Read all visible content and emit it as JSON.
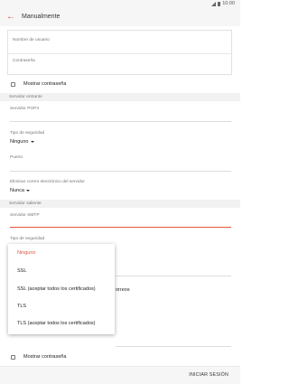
{
  "status_bar": {
    "time": "10:00"
  },
  "header": {
    "title": "Manualmente"
  },
  "account": {
    "username_label": "Nombre de usuario",
    "password_label": "Contraseña"
  },
  "show_password_1": "Mostrar contraseña",
  "incoming": {
    "section": "Servidor entrante",
    "server_label": "Servidor POP3",
    "security_label": "Tipo de seguridad",
    "security_value": "Ninguno",
    "port_label": "Puerto",
    "delete_label": "Eliminar correo electrónico del servidor",
    "delete_value": "Nunca"
  },
  "outgoing": {
    "section": "Servidor saliente",
    "server_label": "Servidor SMTP",
    "security_label": "Tipo de seguridad",
    "hidden_text_fragment": "orreos"
  },
  "dropdown": {
    "options": [
      "Ninguno",
      "SSL",
      "SSL (aceptar todos los certificados)",
      "TLS",
      "TLS (aceptar todos los certificados)"
    ],
    "selected_index": 0
  },
  "show_password_2": "Mostrar contraseña",
  "footer": {
    "sign_in": "INICIAR SESIÓN"
  },
  "colors": {
    "accent": "#e2573e"
  }
}
